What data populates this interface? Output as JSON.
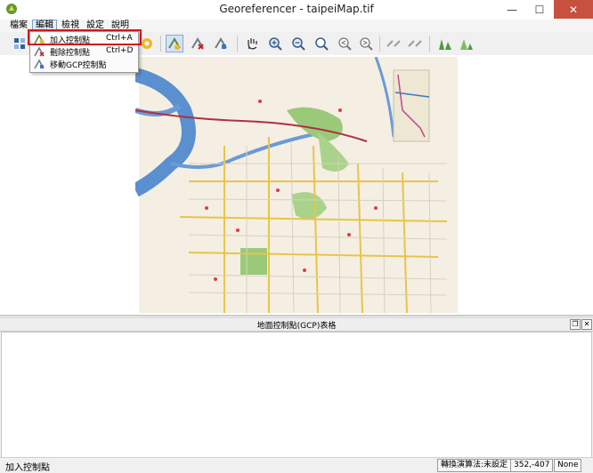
{
  "window": {
    "title": "Georeferencer - taipeiMap.tif",
    "minimize_glyph": "—",
    "maximize_glyph": "☐",
    "close_glyph": "✕"
  },
  "menu": {
    "items": [
      {
        "label": "檔案"
      },
      {
        "label": "編輯"
      },
      {
        "label": "檢視"
      },
      {
        "label": "設定"
      },
      {
        "label": "說明"
      }
    ],
    "active": "編輯"
  },
  "edit_menu": {
    "items": [
      {
        "label": "加入控制點",
        "shortcut": "Ctrl+A",
        "icon": "add-point-icon",
        "highlighted": true
      },
      {
        "label": "刪除控制點",
        "shortcut": "Ctrl+D",
        "icon": "delete-point-icon",
        "highlighted": false
      },
      {
        "label": "移動GCP控制點",
        "shortcut": "",
        "icon": "move-point-icon",
        "highlighted": false
      }
    ]
  },
  "toolbar": {
    "icons": [
      "open-raster-icon",
      "start-georeferencing-icon",
      "gcp-table-icon",
      "settings-icon",
      "add-point-icon",
      "delete-point-icon",
      "move-point-icon",
      "pan-icon",
      "zoom-in-icon",
      "zoom-out-icon",
      "zoom-layer-icon",
      "zoom-last-icon",
      "zoom-next-icon",
      "link-georef-icon",
      "link-qgis-icon",
      "histogram-stretch-icon",
      "histogram-full-icon"
    ]
  },
  "gcp_panel": {
    "title": "地面控制點(GCP)表格"
  },
  "status": {
    "message": "加入控制點",
    "transform": "轉換演算法:未設定",
    "coords": "352,-407",
    "crs": "None"
  },
  "colors": {
    "selection_outline": "#d0141c",
    "close_button": "#c7503f",
    "map_river": "#5a8fd0",
    "map_park": "#9bc97a",
    "map_road": "#e8c44a"
  }
}
